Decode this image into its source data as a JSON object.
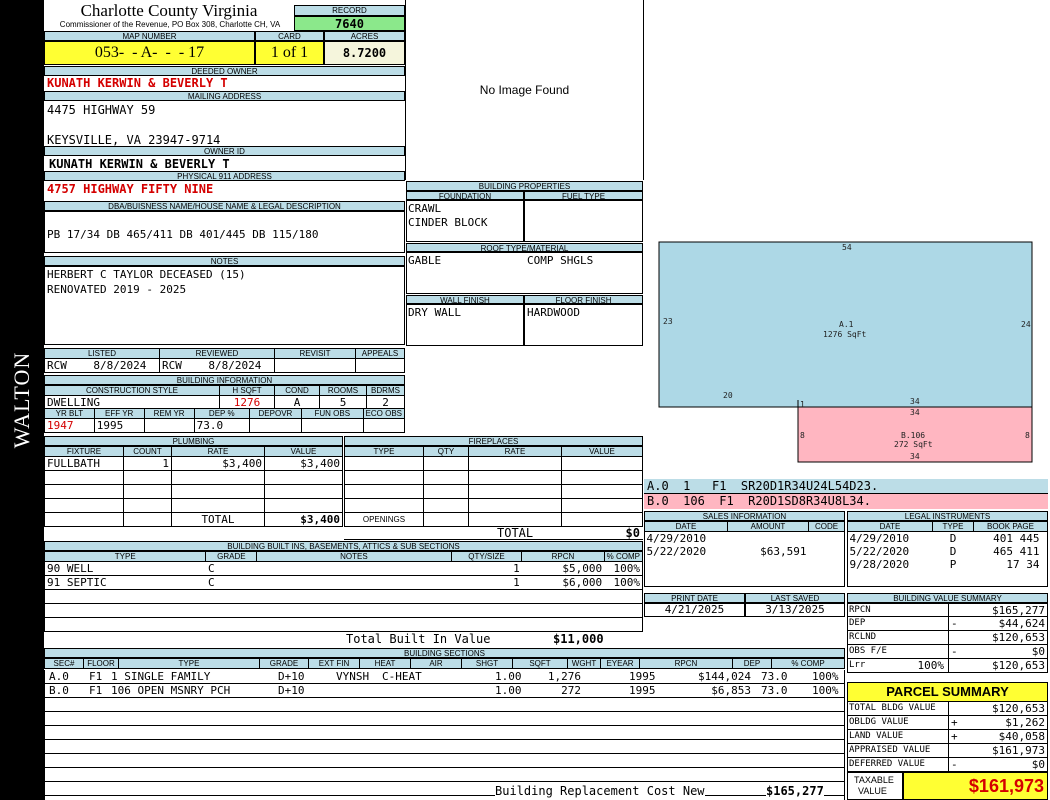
{
  "side_label": "WALTON",
  "header": {
    "county": "Charlotte County Virginia",
    "commissioner": "Commissioner of the Revenue, PO Box 308, Charlotte CH, VA",
    "record_label": "RECORD",
    "record": "7640",
    "map_label": "MAP NUMBER",
    "map_number": "053-  - A-  -  - 17",
    "card_label": "CARD",
    "card": "1 of 1",
    "acres_label": "ACRES",
    "acres": "8.7200"
  },
  "owner": {
    "deeded_label": "DEEDED OWNER",
    "deeded_owner": "KUNATH KERWIN & BEVERLY T",
    "mailing_label": "MAILING ADDRESS",
    "mailing_line1": "4475 HIGHWAY 59",
    "mailing_line2": "KEYSVILLE, VA 23947-9714",
    "owner_id_label": "OWNER ID",
    "owner_id": "KUNATH KERWIN & BEVERLY T",
    "physical_label": "PHYSICAL 911 ADDRESS",
    "physical_address": "4757 HIGHWAY FIFTY NINE",
    "dba_label": "DBA/BUISNESS NAME/HOUSE NAME & LEGAL DESCRIPTION",
    "legal_description": "PB 17/34 DB 465/411 DB 401/445 DB 115/180",
    "notes_label": "NOTES",
    "notes_line1": "HERBERT C TAYLOR DECEASED (15)",
    "notes_line2": "RENOVATED 2019 - 2025"
  },
  "listing": {
    "headers": [
      "LISTED",
      "REVIEWED",
      "REVISIT",
      "APPEALS"
    ],
    "listed": "RCW    8/8/2024",
    "reviewed": "RCW    8/8/2024",
    "revisit": "",
    "appeals": ""
  },
  "building_info": {
    "title": "BUILDING INFORMATION",
    "headers1": [
      "CONSTRUCTION STYLE",
      "H SQFT",
      "COND",
      "ROOMS",
      "BDRMS"
    ],
    "style": "DWELLING",
    "hsqft": "1276",
    "cond": "A",
    "rooms": "5",
    "bdrms": "2",
    "headers2": [
      "YR BLT",
      "EFF YR",
      "REM YR",
      "DEP %",
      "DEPOVR",
      "FUN OBS",
      "ECO OBS"
    ],
    "yr_blt": "1947",
    "eff_yr": "1995",
    "rem_yr": "",
    "dep_pct": "73.0",
    "depovr": "",
    "fun_obs": "",
    "eco_obs": ""
  },
  "image": {
    "no_image": "No Image Found"
  },
  "building_props": {
    "title": "BUILDING PROPERTIES",
    "foundation_label": "FOUNDATION",
    "fuel_label": "FUEL TYPE",
    "foundation1": "CRAWL",
    "foundation2": "CINDER BLOCK",
    "roof_label": "ROOF TYPE/MATERIAL",
    "roof_type": "GABLE",
    "roof_material": "COMP SHGLS",
    "wall_label": "WALL FINISH",
    "floor_label": "FLOOR FINISH",
    "wall": "DRY WALL",
    "floor": "HARDWOOD"
  },
  "sketch": {
    "a_label": "A.1",
    "a_area": "1276 SqFt",
    "b_label": "B.106",
    "b_area": "272 SqFt",
    "dims": {
      "top": "54",
      "left": "23",
      "right": "24",
      "bottom_a": "20",
      "one": "1",
      "b_top1": "34",
      "b_top2": "34",
      "b_left": "8",
      "b_right": "8",
      "b_bottom": "34"
    },
    "code_a": "A.0  1   F1  SR20D1R34U24L54D23.",
    "code_b": "B.0  106  F1  R20D1SD8R34U8L34."
  },
  "plumbing": {
    "title": "PLUMBING",
    "headers": [
      "FIXTURE",
      "COUNT",
      "RATE",
      "VALUE"
    ],
    "rows": [
      [
        "FULLBATH",
        "1",
        "$3,400",
        "$3,400"
      ]
    ],
    "total_label": "TOTAL",
    "total": "$3,400"
  },
  "fireplaces": {
    "title": "FIREPLACES",
    "headers": [
      "TYPE",
      "QTY",
      "RATE",
      "VALUE"
    ],
    "openings_label": "OPENINGS",
    "total_label": "TOTAL",
    "total": "$0"
  },
  "builtins": {
    "title": "BUILDING BUILT INS, BASEMENTS, ATTICS & SUB SECTIONS",
    "headers": [
      "TYPE",
      "GRADE",
      "NOTES",
      "QTY/SIZE",
      "RPCN",
      "% COMP"
    ],
    "rows": [
      [
        "90 WELL",
        "C",
        "",
        "1",
        "$5,000",
        "100%"
      ],
      [
        "91 SEPTIC",
        "C",
        "",
        "1",
        "$6,000",
        "100%"
      ]
    ],
    "total_label": "Total Built In Value",
    "total": "$11,000"
  },
  "sales": {
    "title": "SALES INFORMATION",
    "headers": [
      "DATE",
      "AMOUNT",
      "CODE"
    ],
    "rows": [
      [
        "4/29/2010",
        "",
        ""
      ],
      [
        "5/22/2020",
        "$63,591",
        ""
      ]
    ]
  },
  "legal": {
    "title": "LEGAL INSTRUMENTS",
    "headers": [
      "DATE",
      "TYPE",
      "BOOK PAGE"
    ],
    "rows": [
      [
        "4/29/2010",
        "D",
        "401 445"
      ],
      [
        "5/22/2020",
        "D",
        "465 411"
      ],
      [
        "9/28/2020",
        "P",
        "17 34"
      ]
    ]
  },
  "print": {
    "print_label": "PRINT DATE",
    "saved_label": "LAST SAVED",
    "print_date": "4/21/2025",
    "last_saved": "3/13/2025"
  },
  "bvs": {
    "title": "BUILDING VALUE SUMMARY",
    "rows": [
      {
        "label": "RPCN",
        "sign": "",
        "value": "$165,277"
      },
      {
        "label": "DEP",
        "sign": "-",
        "value": "$44,624"
      },
      {
        "label": "RCLND",
        "sign": "",
        "value": "$120,653"
      },
      {
        "label": "OBS F/E",
        "sign": "-",
        "value": "$0"
      },
      {
        "label": "Lrr",
        "pct": "100%",
        "sign": "",
        "value": "$120,653"
      }
    ]
  },
  "sections": {
    "title": "BUILDING SECTIONS",
    "headers": [
      "SEC#",
      "FLOOR",
      "TYPE",
      "GRADE",
      "EXT FIN",
      "HEAT",
      "AIR",
      "SHGT",
      "SQFT",
      "WGHT",
      "EYEAR",
      "RPCN",
      "DEP",
      "% COMP"
    ],
    "rows": [
      [
        "A.0",
        "F1",
        "1 SINGLE FAMILY",
        "D+10",
        "VYNSH",
        "C-HEAT",
        "",
        "1.00",
        "1,276",
        "",
        "1995",
        "$144,024",
        "73.0",
        "100%"
      ],
      [
        "B.0",
        "F1",
        "106 OPEN MSNRY PCH",
        "D+10",
        "",
        "",
        "",
        "1.00",
        "272",
        "",
        "1995",
        "$6,853",
        "73.0",
        "100%"
      ]
    ],
    "brcn_label": "Building Replacement Cost New",
    "brcn": "$165,277"
  },
  "parcel": {
    "title": "PARCEL SUMMARY",
    "rows": [
      {
        "label": "TOTAL BLDG VALUE",
        "sign": "",
        "value": "$120,653"
      },
      {
        "label": "OBLDG VALUE",
        "sign": "+",
        "value": "$1,262"
      },
      {
        "label": "LAND VALUE",
        "sign": "+",
        "value": "$40,058"
      },
      {
        "label": "APPRAISED VALUE",
        "sign": "",
        "value": "$161,973"
      },
      {
        "label": "DEFERRED VALUE",
        "sign": "-",
        "value": "$0"
      }
    ],
    "taxable_label1": "TAXABLE",
    "taxable_label2": "VALUE",
    "taxable": "$161,973"
  },
  "colors": {
    "header_blue": "#bcdde7",
    "yellow": "#ffff33",
    "record_green": "#8be88b",
    "sketch_blue": "#add8e6",
    "sketch_pink": "#ffb6c1",
    "red": "#d40000"
  }
}
